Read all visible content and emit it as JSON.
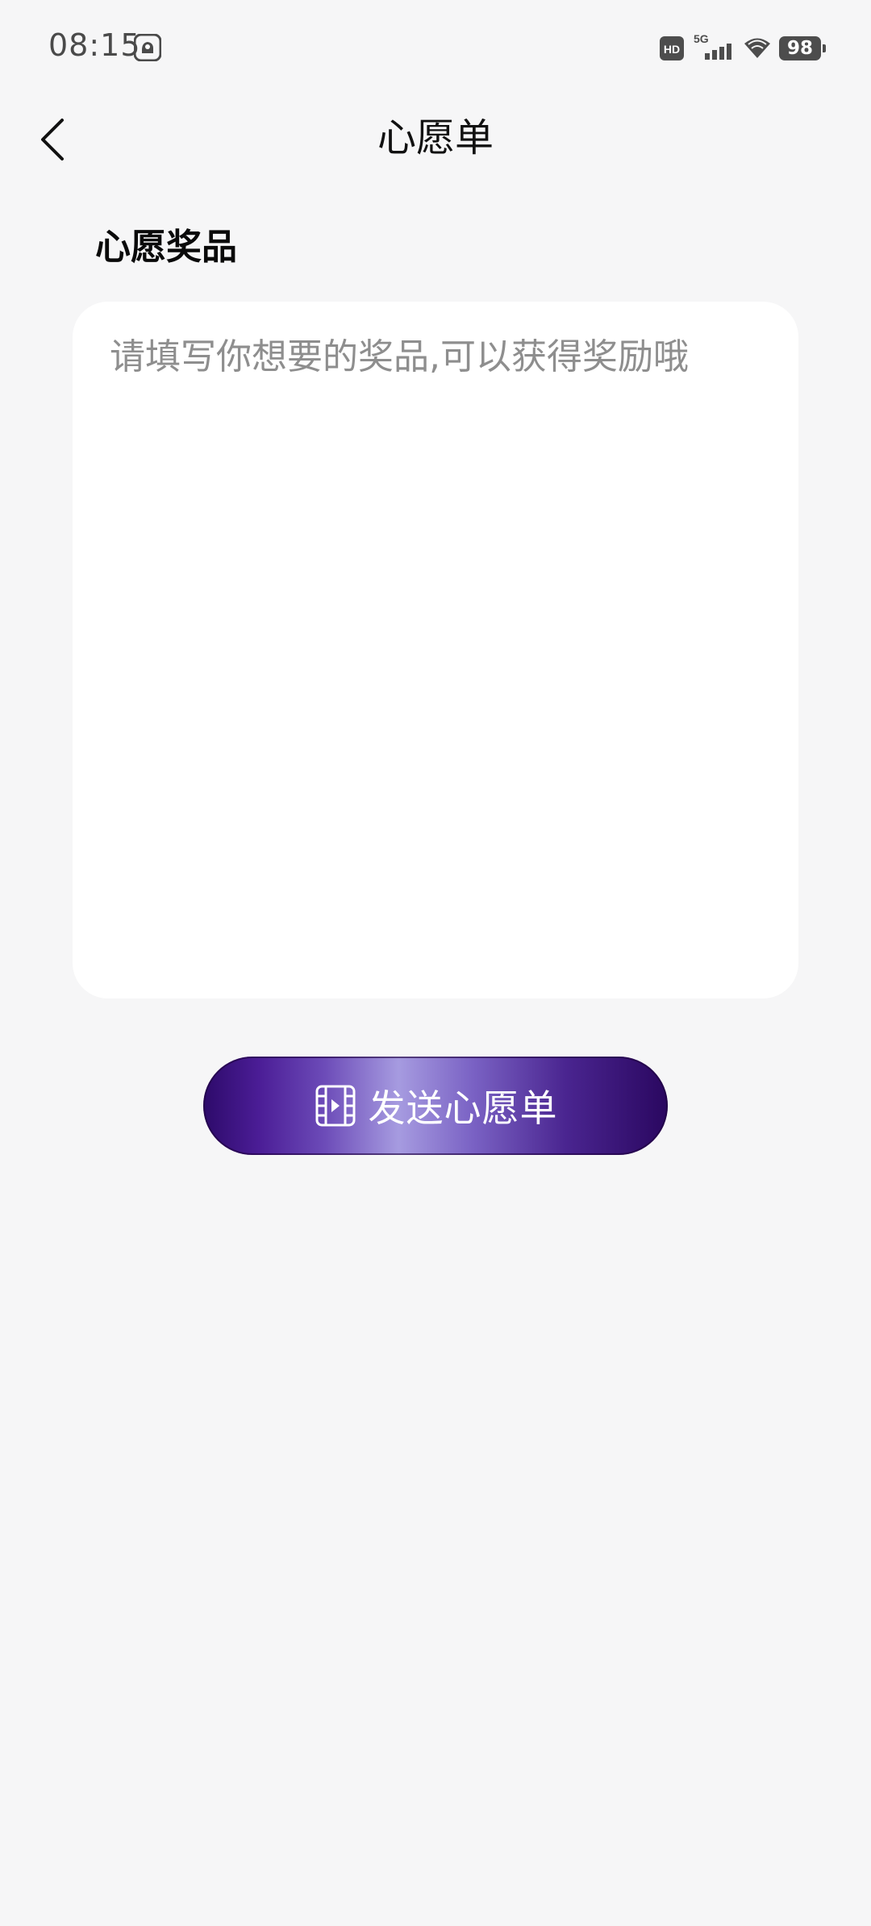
{
  "status_bar": {
    "time": "08:15",
    "battery": "98",
    "icons": [
      "app-notification-icon",
      "hd-icon",
      "signal-5g-icon",
      "wifi-icon",
      "battery-icon"
    ]
  },
  "header": {
    "title": "心愿单",
    "back_icon": "chevron-left-icon"
  },
  "section": {
    "title": "心愿奖品"
  },
  "wish_input": {
    "value": "",
    "placeholder": "请填写你想要的奖品,可以获得奖励哦"
  },
  "send_button": {
    "label": "发送心愿单",
    "icon": "film-play-icon"
  },
  "colors": {
    "background": "#f6f6f7",
    "card": "#ffffff",
    "button_dark": "#2d0a6a",
    "button_light": "#a69be0"
  }
}
